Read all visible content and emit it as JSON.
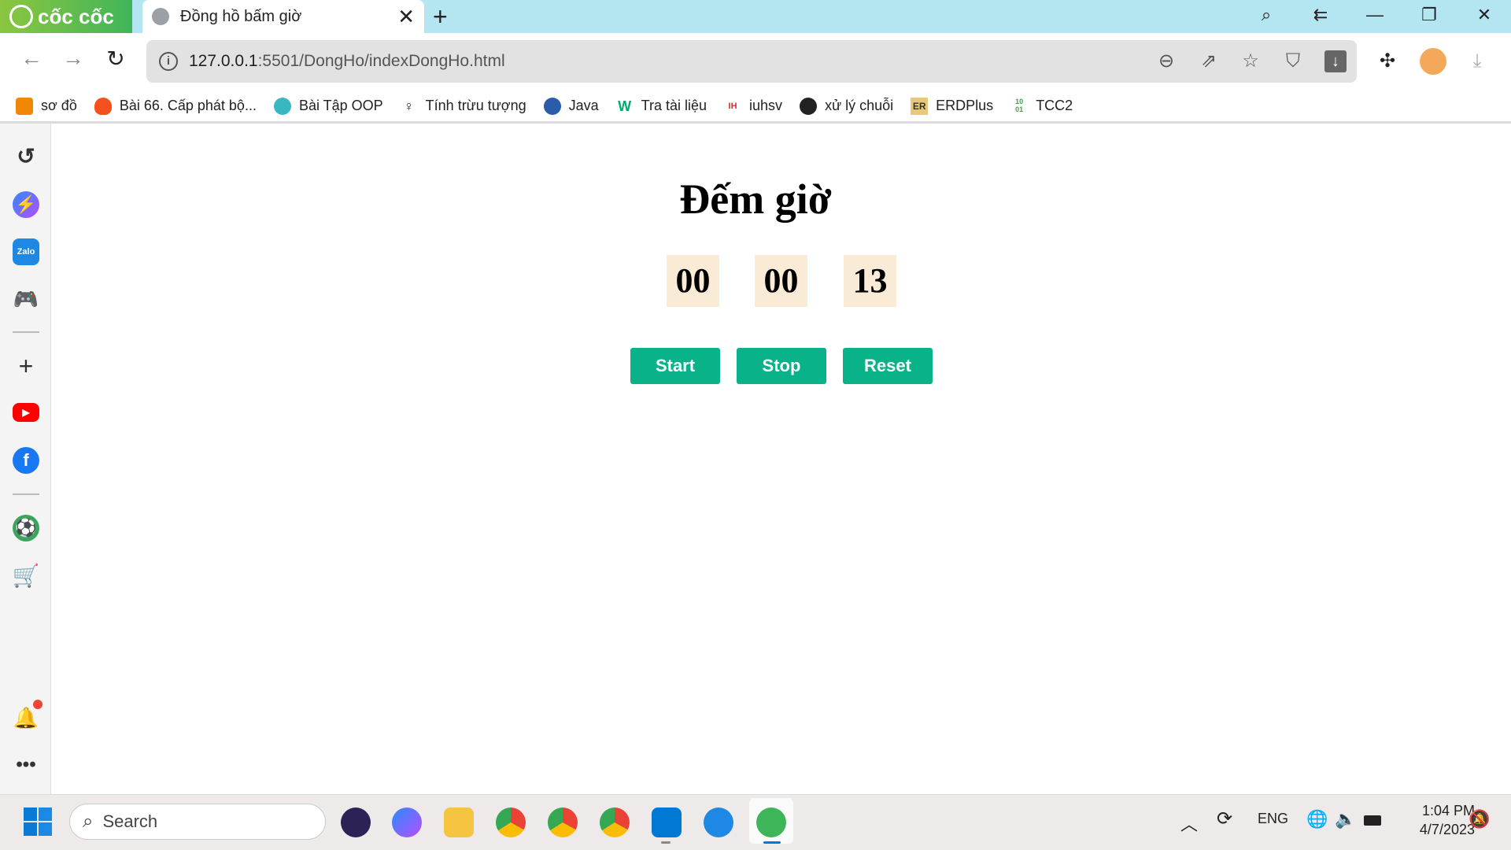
{
  "browser": {
    "brand": "cốc cốc",
    "tab_title": "Đồng hồ bấm giờ",
    "url_host": "127.0.0.1",
    "url_path": ":5501/DongHo/indexDongHo.html",
    "bookmarks": [
      {
        "label": "sơ đồ",
        "icon": "drawio-icon",
        "color": "#f08705"
      },
      {
        "label": "Bài 66. Cấp phát bộ...",
        "icon": "fire-icon",
        "color": "#f4511e"
      },
      {
        "label": "Bài Tập OOP",
        "icon": "dpt-icon",
        "color": "#3bb7c4"
      },
      {
        "label": "Tính trừu tượng",
        "icon": "person-icon",
        "color": "#333"
      },
      {
        "label": "Java",
        "icon": "java-globe-icon",
        "color": "#2a5caa"
      },
      {
        "label": "Tra tài liệu",
        "icon": "w3-icon",
        "color": "#04aa6d"
      },
      {
        "label": "iuhsv",
        "icon": "iuh-icon",
        "color": "#d32f2f"
      },
      {
        "label": "xử lý chuỗi",
        "icon": "globe-icon",
        "color": "#222"
      },
      {
        "label": "ERDPlus",
        "icon": "er-icon",
        "color": "#e8c87a"
      },
      {
        "label": "TCC2",
        "icon": "binary-icon",
        "color": "#43a047"
      }
    ]
  },
  "page": {
    "title": "Đếm giờ",
    "hours": "00",
    "minutes": "00",
    "seconds": "13",
    "start_label": "Start",
    "stop_label": "Stop",
    "reset_label": "Reset",
    "accent": "#0ab28a"
  },
  "taskbar": {
    "search_placeholder": "Search",
    "language": "ENG",
    "time": "1:04 PM",
    "date": "4/7/2023"
  }
}
